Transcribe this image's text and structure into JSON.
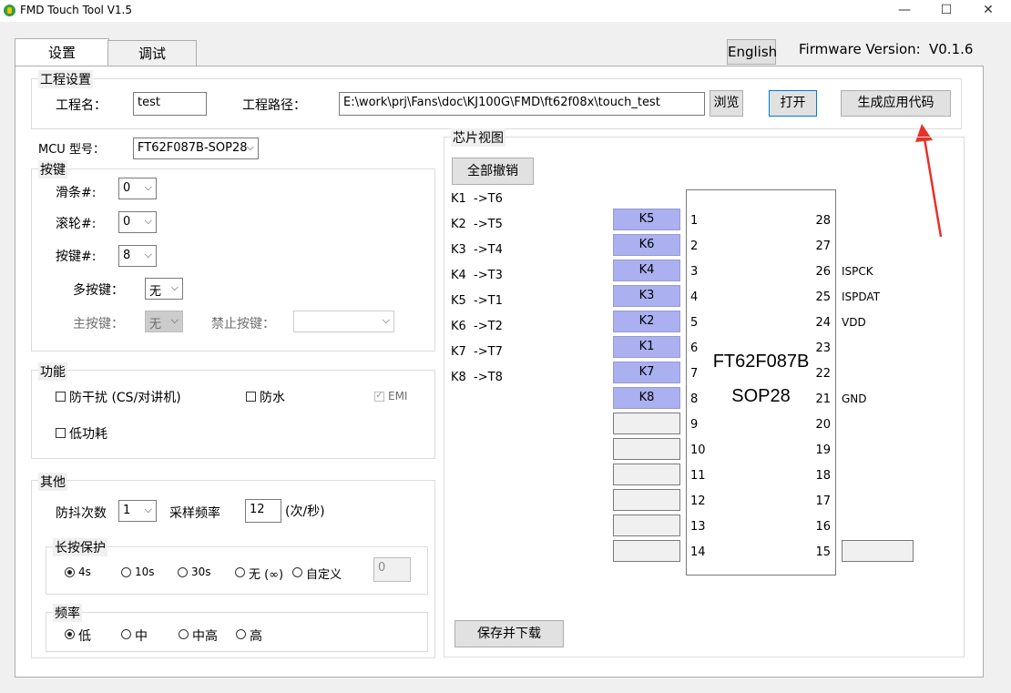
{
  "window": {
    "title": "FMD Touch Tool V1.5",
    "min": "—",
    "max": "☐",
    "close": "✕"
  },
  "tabs": [
    {
      "label": "设置"
    },
    {
      "label": "调试"
    }
  ],
  "header": {
    "english_label": "English",
    "firmware_label": "Firmware Version:",
    "firmware_value": "V0.1.6"
  },
  "project": {
    "group_title": "工程设置",
    "name_label": "工程名：",
    "name_value": "test",
    "path_label": "工程路径：",
    "path_value": "E:\\work\\prj\\Fans\\doc\\KJ100G\\FMD\\ft62f08x\\touch_test",
    "browse_label": "浏览",
    "open_label": "打开",
    "gen_label": "生成应用代码"
  },
  "mcu": {
    "label": "MCU 型号：",
    "value": "FT62F087B-SOP28"
  },
  "keys": {
    "group_title": "按键",
    "slider_label": "滑条#:",
    "slider_value": "0",
    "wheel_label": "滚轮#:",
    "wheel_value": "0",
    "button_label": "按键#:",
    "button_value": "8",
    "multi_label": "多按键：",
    "multi_value": "无",
    "main_label": "主按键：",
    "main_value": "无",
    "forbid_label": "禁止按键：",
    "forbid_value": ""
  },
  "function": {
    "group_title": "功能",
    "anti_interference": "防干扰 (CS/对讲机)",
    "waterproof": "防水",
    "emi": "EMI",
    "low_power": "低功耗"
  },
  "other": {
    "group_title": "其他",
    "debounce_label": "防抖次数",
    "debounce_value": "1",
    "sample_label": "采样频率",
    "sample_value": "12",
    "sample_unit": "(次/秒)",
    "longpress": {
      "title": "长按保护",
      "options": [
        "4s",
        "10s",
        "30s",
        "无 (∞)",
        "自定义"
      ],
      "selected": "4s",
      "custom_value": "0"
    },
    "freq": {
      "title": "频率",
      "options": [
        "低",
        "中",
        "中高",
        "高"
      ],
      "selected": "低"
    }
  },
  "chip_view": {
    "group_title": "芯片视图",
    "undo_all_label": "全部撤销",
    "mappings": [
      "K1  ->T6",
      "K2  ->T5",
      "K3  ->T4",
      "K4  ->T3",
      "K5  ->T1",
      "K6  ->T2",
      "K7  ->T7",
      "K8  ->T8"
    ],
    "left_keys": [
      "K5",
      "K6",
      "K4",
      "K3",
      "K2",
      "K1",
      "K7",
      "K8",
      "",
      "",
      "",
      "",
      "",
      ""
    ],
    "left_pins": [
      "1",
      "2",
      "3",
      "4",
      "5",
      "6",
      "7",
      "8",
      "9",
      "10",
      "11",
      "12",
      "13",
      "14"
    ],
    "right_pins": [
      "28",
      "27",
      "26",
      "25",
      "24",
      "23",
      "22",
      "21",
      "20",
      "19",
      "18",
      "17",
      "16",
      "15"
    ],
    "right_labels": [
      "",
      "",
      "ISPCK",
      "ISPDAT",
      "VDD",
      "",
      "",
      "GND",
      "",
      "",
      "",
      "",
      "",
      ""
    ],
    "chip_name": "FT62F087B",
    "chip_package": "SOP28",
    "save_download_label": "保存并下载"
  },
  "colors": {
    "key_fill": "#aab0f0",
    "annotation_arrow": "#e8312a"
  }
}
